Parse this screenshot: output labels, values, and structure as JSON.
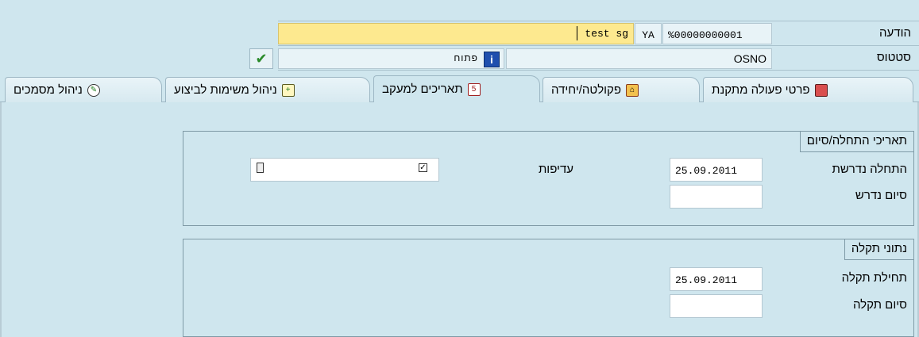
{
  "header": {
    "message_label": "הודעה",
    "message_value": "test sg",
    "message_code": "YA",
    "message_number": "%00000000001",
    "status_label": "סטטוס",
    "status_text": "פתוח",
    "status_code": "OSNO"
  },
  "tabs": [
    {
      "label": "פרטי פעולה מתקנת",
      "icon": "book-icon",
      "active": false
    },
    {
      "label": "פקולטה/יחידה",
      "icon": "building-icon",
      "active": false
    },
    {
      "label": "תאריכים למעקב",
      "icon": "calendar-icon",
      "active": true
    },
    {
      "label": "ניהול משימות לביצוע",
      "icon": "task-list-icon",
      "active": false
    },
    {
      "label": "ניהול מסמכים",
      "icon": "document-icon",
      "active": false
    }
  ],
  "dates_group": {
    "title": "תאריכי התחלה/סיום",
    "required_start_label": "התחלה נדרשת",
    "required_start_value": "25.09.2011",
    "required_end_label": "סיום נדרש",
    "required_end_value": "",
    "priority_label": "עדיפות",
    "priority_value": ""
  },
  "standard_group": {
    "title": "נתוני תקלה",
    "start_label": "תחילת תקלה",
    "start_value": "25.09.2011",
    "end_label": "סיום תקלה",
    "end_value": ""
  },
  "colors": {
    "background": "#cfe6ee",
    "highlight_field": "#fde98f",
    "border": "#7f9aa6"
  }
}
